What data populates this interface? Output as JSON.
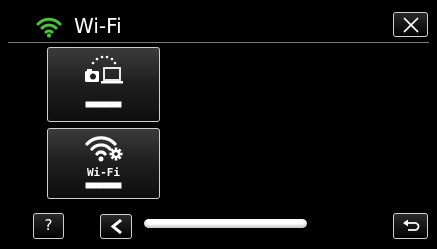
{
  "header": {
    "title": "Wi-Fi",
    "wifi_icon": "wifi-signal-icon",
    "close_icon": "close-icon"
  },
  "tiles": [
    {
      "icon": "send-to-laptop-icon",
      "masked_text": "■■■■■■"
    },
    {
      "icon": "wifi-settings-icon",
      "label": "Wi-Fi",
      "masked_text": "■■■■■■"
    }
  ],
  "footer": {
    "help_label": "?",
    "prev_icon": "chevron-left-icon",
    "back_icon": "return-icon",
    "page_scroll_position": 0
  },
  "colors": {
    "background": "#000000",
    "accent_green": "#4cc33a",
    "text": "#ffffff",
    "border": "#cfcfcf"
  }
}
